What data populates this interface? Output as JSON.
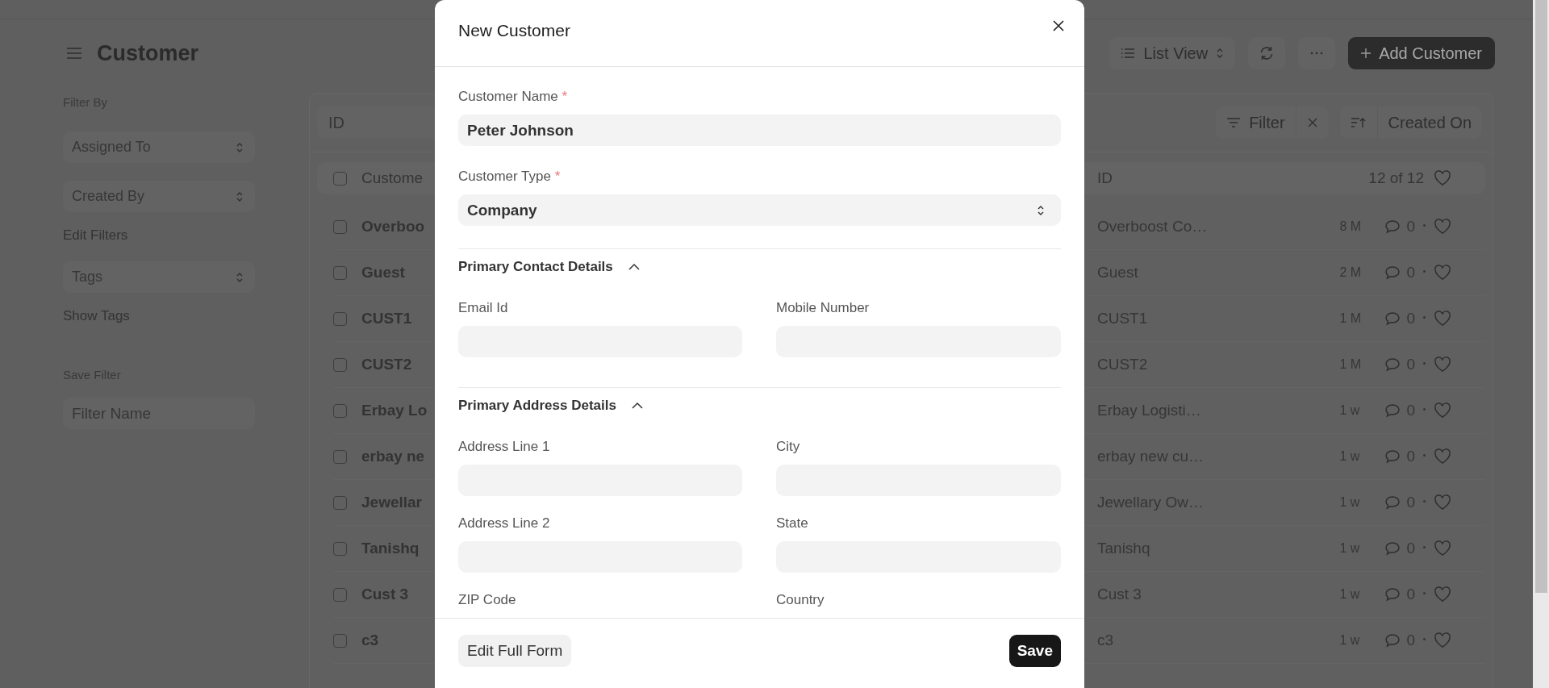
{
  "page_title": "Customer",
  "sidebar": {
    "filter_heading": "Filter By",
    "filters": [
      {
        "label": "Assigned To"
      },
      {
        "label": "Created By"
      }
    ],
    "edit_filters": "Edit Filters",
    "tags": {
      "label": "Tags"
    },
    "show_tags": "Show Tags",
    "save_heading": "Save Filter",
    "filter_name": {
      "placeholder": "Filter Name"
    }
  },
  "toolbar": {
    "view": "List View",
    "add_button": "Add Customer"
  },
  "list": {
    "id_filter": {
      "placeholder": "ID"
    },
    "filter_button": "Filter",
    "sort_field": "Created On",
    "header": {
      "column_1": "Custome",
      "column_2": "ID",
      "count": "12 of 12",
      "checked": false
    },
    "rows": [
      {
        "name": "Overboo",
        "id": "Overboost Co…",
        "age": "8 M",
        "comments": "0",
        "checked": false
      },
      {
        "name": "Guest",
        "id": "Guest",
        "age": "2 M",
        "comments": "0",
        "checked": false
      },
      {
        "name": "CUST1",
        "id": "CUST1",
        "age": "1 M",
        "comments": "0",
        "checked": false
      },
      {
        "name": "CUST2",
        "id": "CUST2",
        "age": "1 M",
        "comments": "0",
        "checked": false
      },
      {
        "name": "Erbay Lo",
        "id": "Erbay Logisti…",
        "age": "1 w",
        "comments": "0",
        "checked": false
      },
      {
        "name": "erbay ne",
        "id": "erbay new cu…",
        "age": "1 w",
        "comments": "0",
        "checked": false
      },
      {
        "name": "Jewellar",
        "id": "Jewellary Ow…",
        "age": "1 w",
        "comments": "0",
        "checked": false
      },
      {
        "name": "Tanishq",
        "id": "Tanishq",
        "age": "1 w",
        "comments": "0",
        "checked": false
      },
      {
        "name": "Cust 3",
        "id": "Cust 3",
        "age": "1 w",
        "comments": "0",
        "checked": false
      },
      {
        "name": "c3",
        "id": "c3",
        "age": "1 w",
        "comments": "0",
        "checked": false
      }
    ]
  },
  "dialog": {
    "title": "New Customer",
    "fields": [
      {
        "label": "Customer Name",
        "required_mark": "*",
        "kind": "text",
        "value": "Peter Johnson"
      },
      {
        "label": "Customer Type",
        "required_mark": "*",
        "kind": "select",
        "value": "Company"
      }
    ],
    "sections": [
      {
        "title": "Primary Contact Details",
        "expanded": true,
        "fields": [
          {
            "label": "Email Id"
          },
          {
            "label": "Mobile Number"
          }
        ]
      },
      {
        "title": "Primary Address Details",
        "expanded": true,
        "fields": [
          {
            "label": "Address Line 1"
          },
          {
            "label": "City"
          },
          {
            "label": "Address Line 2"
          },
          {
            "label": "State"
          },
          {
            "label": "ZIP Code"
          },
          {
            "label": "Country"
          }
        ]
      }
    ],
    "footer": {
      "secondary": "Edit Full Form",
      "primary": "Save"
    }
  }
}
